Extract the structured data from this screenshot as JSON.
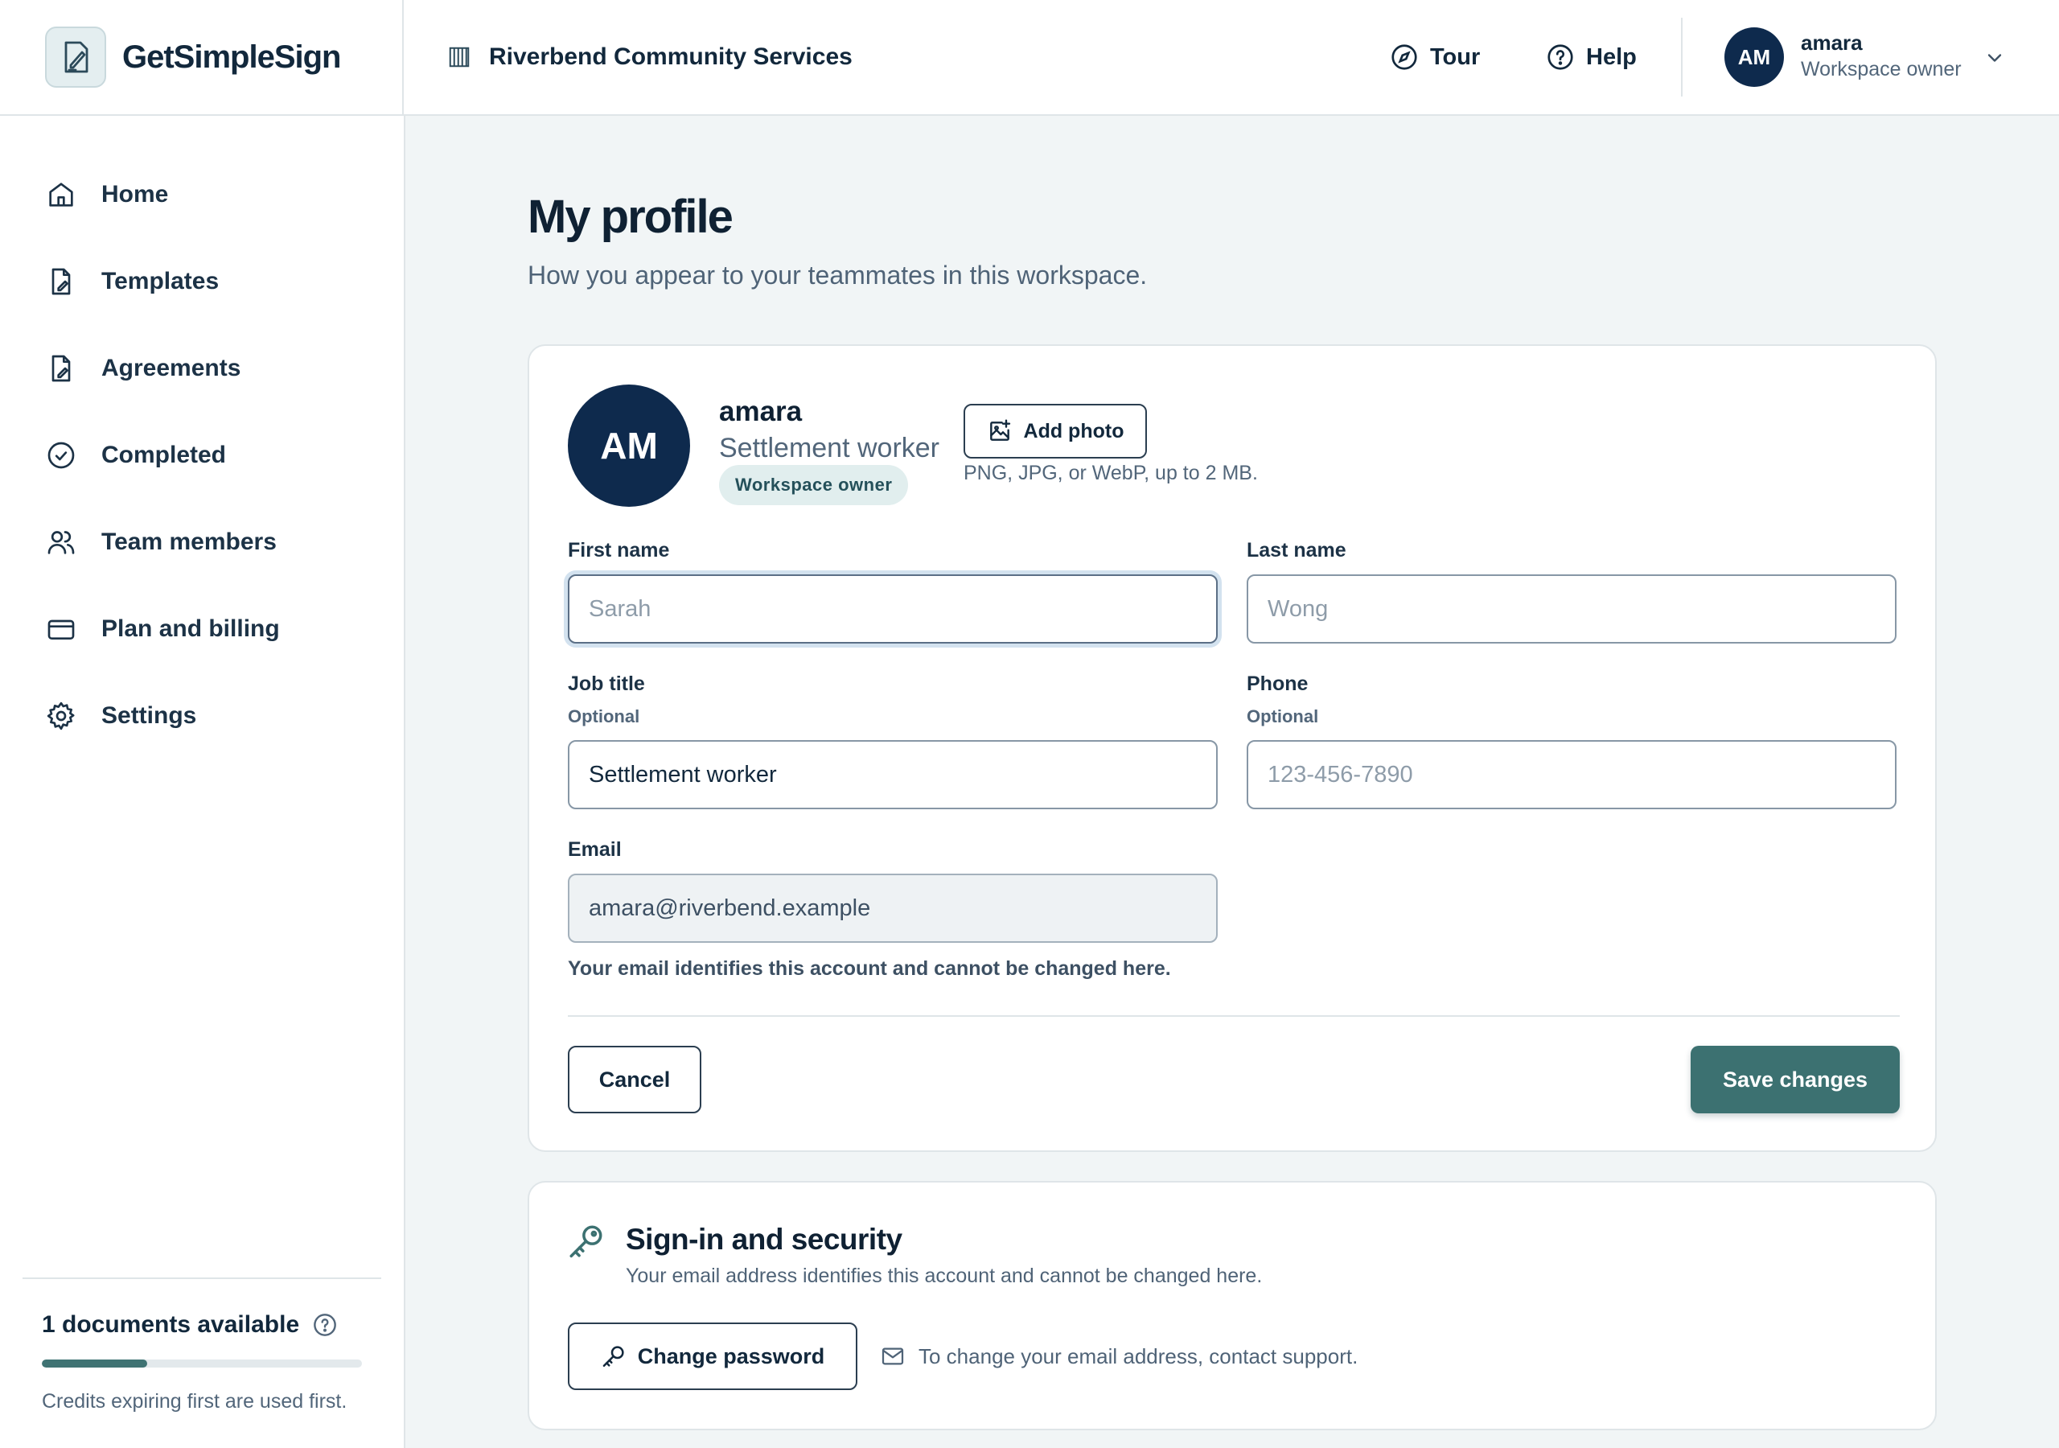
{
  "brand": {
    "name": "GetSimpleSign"
  },
  "header": {
    "org_name": "Riverbend Community Services",
    "tour_label": "Tour",
    "help_label": "Help",
    "user": {
      "initials": "AM",
      "name": "amara",
      "role": "Workspace owner"
    }
  },
  "sidebar": {
    "items": [
      {
        "label": "Home",
        "icon": "home-icon"
      },
      {
        "label": "Templates",
        "icon": "template-icon"
      },
      {
        "label": "Agreements",
        "icon": "agreement-icon"
      },
      {
        "label": "Completed",
        "icon": "check-circle-icon"
      },
      {
        "label": "Team members",
        "icon": "users-icon"
      },
      {
        "label": "Plan and billing",
        "icon": "card-icon"
      },
      {
        "label": "Settings",
        "icon": "gear-icon"
      }
    ],
    "documents": {
      "title": "1 documents available",
      "progress_fraction": 0.33,
      "note": "Credits expiring first are used first."
    }
  },
  "page": {
    "title": "My profile",
    "subtitle": "How you appear to your teammates in this workspace."
  },
  "profile": {
    "initials": "AM",
    "name": "amara",
    "job": "Settlement worker",
    "badge": "Workspace owner",
    "add_photo_label": "Add photo",
    "photo_note": "PNG, JPG, or WebP, up to 2 MB."
  },
  "form": {
    "first_name": {
      "label": "First name",
      "value": "",
      "placeholder": "Sarah"
    },
    "last_name": {
      "label": "Last name",
      "value": "",
      "placeholder": "Wong"
    },
    "job_title": {
      "label": "Job title",
      "hint": "Optional",
      "value": "Settlement worker"
    },
    "phone": {
      "label": "Phone",
      "hint": "Optional",
      "value": "",
      "placeholder": "123-456-7890"
    },
    "email": {
      "label": "Email",
      "value": "amara@riverbend.example",
      "note": "Your email identifies this account and cannot be changed here."
    },
    "cancel_label": "Cancel",
    "save_label": "Save changes"
  },
  "security": {
    "title": "Sign-in and security",
    "subtitle": "Your email address identifies this account and cannot be changed here.",
    "change_password_label": "Change password",
    "support_note": "To change your email address, contact support."
  },
  "colors": {
    "accent": "#3c7171",
    "avatar": "#0e2a4d",
    "badge_bg": "#e1eeee"
  }
}
